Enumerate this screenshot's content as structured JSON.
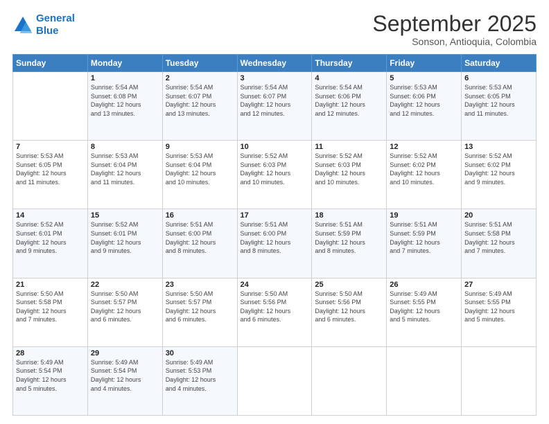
{
  "logo": {
    "line1": "General",
    "line2": "Blue"
  },
  "header": {
    "title": "September 2025",
    "subtitle": "Sonson, Antioquia, Colombia"
  },
  "days_of_week": [
    "Sunday",
    "Monday",
    "Tuesday",
    "Wednesday",
    "Thursday",
    "Friday",
    "Saturday"
  ],
  "weeks": [
    [
      {
        "num": "",
        "info": ""
      },
      {
        "num": "1",
        "info": "Sunrise: 5:54 AM\nSunset: 6:08 PM\nDaylight: 12 hours\nand 13 minutes."
      },
      {
        "num": "2",
        "info": "Sunrise: 5:54 AM\nSunset: 6:07 PM\nDaylight: 12 hours\nand 13 minutes."
      },
      {
        "num": "3",
        "info": "Sunrise: 5:54 AM\nSunset: 6:07 PM\nDaylight: 12 hours\nand 12 minutes."
      },
      {
        "num": "4",
        "info": "Sunrise: 5:54 AM\nSunset: 6:06 PM\nDaylight: 12 hours\nand 12 minutes."
      },
      {
        "num": "5",
        "info": "Sunrise: 5:53 AM\nSunset: 6:06 PM\nDaylight: 12 hours\nand 12 minutes."
      },
      {
        "num": "6",
        "info": "Sunrise: 5:53 AM\nSunset: 6:05 PM\nDaylight: 12 hours\nand 11 minutes."
      }
    ],
    [
      {
        "num": "7",
        "info": "Sunrise: 5:53 AM\nSunset: 6:05 PM\nDaylight: 12 hours\nand 11 minutes."
      },
      {
        "num": "8",
        "info": "Sunrise: 5:53 AM\nSunset: 6:04 PM\nDaylight: 12 hours\nand 11 minutes."
      },
      {
        "num": "9",
        "info": "Sunrise: 5:53 AM\nSunset: 6:04 PM\nDaylight: 12 hours\nand 10 minutes."
      },
      {
        "num": "10",
        "info": "Sunrise: 5:52 AM\nSunset: 6:03 PM\nDaylight: 12 hours\nand 10 minutes."
      },
      {
        "num": "11",
        "info": "Sunrise: 5:52 AM\nSunset: 6:03 PM\nDaylight: 12 hours\nand 10 minutes."
      },
      {
        "num": "12",
        "info": "Sunrise: 5:52 AM\nSunset: 6:02 PM\nDaylight: 12 hours\nand 10 minutes."
      },
      {
        "num": "13",
        "info": "Sunrise: 5:52 AM\nSunset: 6:02 PM\nDaylight: 12 hours\nand 9 minutes."
      }
    ],
    [
      {
        "num": "14",
        "info": "Sunrise: 5:52 AM\nSunset: 6:01 PM\nDaylight: 12 hours\nand 9 minutes."
      },
      {
        "num": "15",
        "info": "Sunrise: 5:52 AM\nSunset: 6:01 PM\nDaylight: 12 hours\nand 9 minutes."
      },
      {
        "num": "16",
        "info": "Sunrise: 5:51 AM\nSunset: 6:00 PM\nDaylight: 12 hours\nand 8 minutes."
      },
      {
        "num": "17",
        "info": "Sunrise: 5:51 AM\nSunset: 6:00 PM\nDaylight: 12 hours\nand 8 minutes."
      },
      {
        "num": "18",
        "info": "Sunrise: 5:51 AM\nSunset: 5:59 PM\nDaylight: 12 hours\nand 8 minutes."
      },
      {
        "num": "19",
        "info": "Sunrise: 5:51 AM\nSunset: 5:59 PM\nDaylight: 12 hours\nand 7 minutes."
      },
      {
        "num": "20",
        "info": "Sunrise: 5:51 AM\nSunset: 5:58 PM\nDaylight: 12 hours\nand 7 minutes."
      }
    ],
    [
      {
        "num": "21",
        "info": "Sunrise: 5:50 AM\nSunset: 5:58 PM\nDaylight: 12 hours\nand 7 minutes."
      },
      {
        "num": "22",
        "info": "Sunrise: 5:50 AM\nSunset: 5:57 PM\nDaylight: 12 hours\nand 6 minutes."
      },
      {
        "num": "23",
        "info": "Sunrise: 5:50 AM\nSunset: 5:57 PM\nDaylight: 12 hours\nand 6 minutes."
      },
      {
        "num": "24",
        "info": "Sunrise: 5:50 AM\nSunset: 5:56 PM\nDaylight: 12 hours\nand 6 minutes."
      },
      {
        "num": "25",
        "info": "Sunrise: 5:50 AM\nSunset: 5:56 PM\nDaylight: 12 hours\nand 6 minutes."
      },
      {
        "num": "26",
        "info": "Sunrise: 5:49 AM\nSunset: 5:55 PM\nDaylight: 12 hours\nand 5 minutes."
      },
      {
        "num": "27",
        "info": "Sunrise: 5:49 AM\nSunset: 5:55 PM\nDaylight: 12 hours\nand 5 minutes."
      }
    ],
    [
      {
        "num": "28",
        "info": "Sunrise: 5:49 AM\nSunset: 5:54 PM\nDaylight: 12 hours\nand 5 minutes."
      },
      {
        "num": "29",
        "info": "Sunrise: 5:49 AM\nSunset: 5:54 PM\nDaylight: 12 hours\nand 4 minutes."
      },
      {
        "num": "30",
        "info": "Sunrise: 5:49 AM\nSunset: 5:53 PM\nDaylight: 12 hours\nand 4 minutes."
      },
      {
        "num": "",
        "info": ""
      },
      {
        "num": "",
        "info": ""
      },
      {
        "num": "",
        "info": ""
      },
      {
        "num": "",
        "info": ""
      }
    ]
  ]
}
